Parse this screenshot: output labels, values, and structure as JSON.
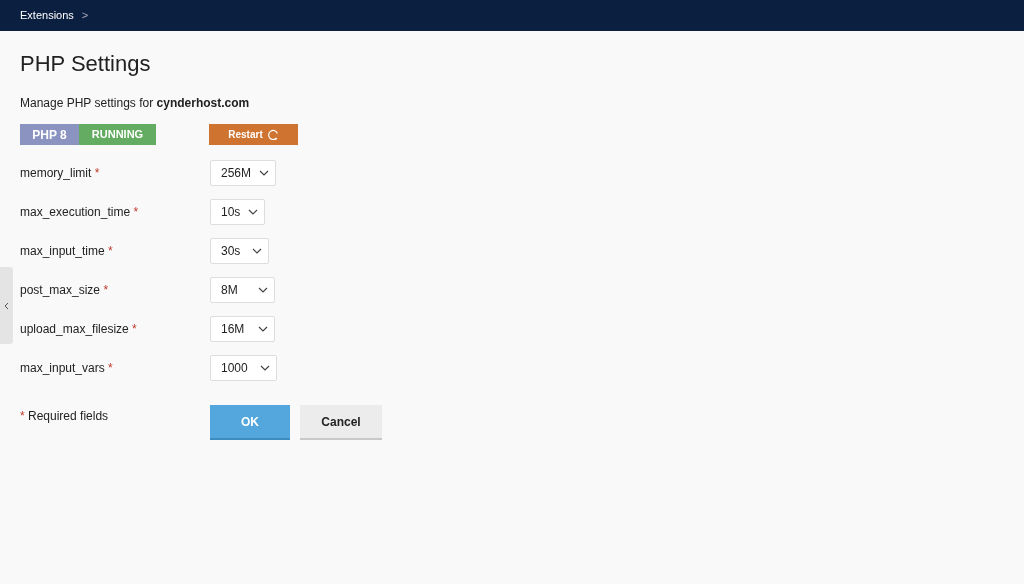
{
  "breadcrumb": {
    "label": "Extensions",
    "separator": ">"
  },
  "title": "PHP Settings",
  "subtitle": "Manage PHP settings for **cynderhost.com**",
  "status": {
    "version": "PHP 8",
    "state": "RUNNING"
  },
  "restart_button": "Restart",
  "fields": [
    {
      "label": "memory_limit",
      "mark": "*",
      "value": "256M"
    },
    {
      "label": "max_execution_time",
      "mark": "*",
      "value": "10s"
    },
    {
      "label": "max_input_time",
      "mark": "*",
      "value": "30s"
    },
    {
      "label": "post_max_size",
      "mark": "*",
      "value": "8M"
    },
    {
      "label": "upload_max_filesize",
      "mark": "*",
      "value": "16M"
    },
    {
      "label": "max_input_vars",
      "mark": "*",
      "value": "1000"
    }
  ],
  "required_note": {
    "mark": "*",
    "text": "Required fields"
  },
  "buttons": [
    {
      "label": "OK",
      "kind": "primary"
    },
    {
      "label": "Cancel",
      "kind": "secondary"
    }
  ]
}
